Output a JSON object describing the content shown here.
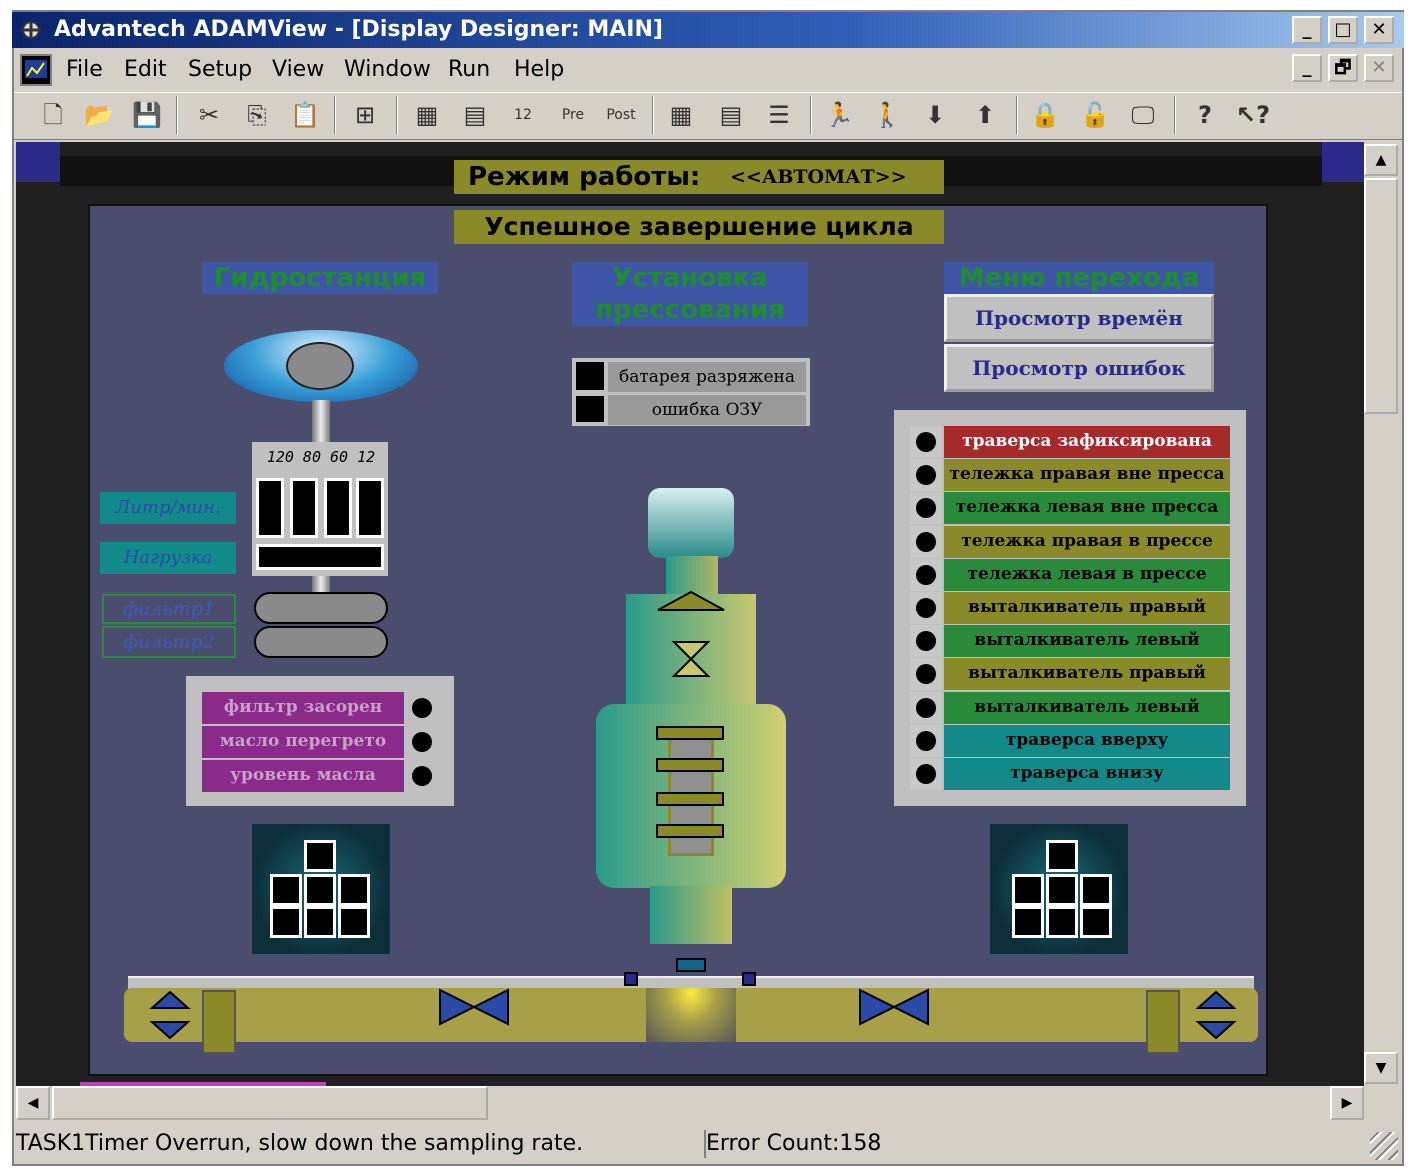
{
  "window": {
    "title": "Advantech ADAMView - [Display Designer: MAIN]",
    "controls": [
      "_",
      "□",
      "✕"
    ],
    "mdi_controls": [
      "_",
      "🗗",
      "✕"
    ]
  },
  "menu": [
    "File",
    "Edit",
    "Setup",
    "View",
    "Window",
    "Run",
    "Help"
  ],
  "toolbar": {
    "icons": [
      "new-file-icon",
      "open-folder-icon",
      "save-icon",
      "cut-icon",
      "copy-icon",
      "paste-icon",
      "insert-icon",
      "task-icon",
      "task-config-icon",
      "calendar-icon",
      "pre-icon",
      "post-icon",
      "block-icon",
      "block-config-icon",
      "list-icon",
      "run-icon",
      "stop-icon",
      "download-icon",
      "upload-icon",
      "lock-icon",
      "unlock-icon",
      "monitor-icon",
      "help-icon",
      "context-help-icon"
    ],
    "labels": {
      "pre": "Pre",
      "post": "Post",
      "calendar": "12"
    }
  },
  "display": {
    "mode_label": "Режим работы:",
    "mode_value": "<<АВТОМАТ>>",
    "cycle_status": "Успешное завершение цикла",
    "headers": {
      "hydro": "Гидростанция",
      "press": "Установка прессования",
      "menu": "Меню перехода"
    },
    "menu_buttons": [
      "Просмотр времён",
      "Просмотр ошибок"
    ],
    "press_alarms": [
      "батарея разряжена",
      "ошибка ОЗУ"
    ],
    "gauge_scale": "120 80 60 12",
    "hydro_labels": [
      "Литр/мин.",
      "Нагрузка"
    ],
    "filter_labels": [
      "фильтр1",
      "фильтр2"
    ],
    "hydro_alarms": [
      "фильтр засорен",
      "масло перегрето",
      "уровень масла"
    ],
    "status_list": [
      {
        "text": "траверса зафиксирована",
        "color": "#a52a2a",
        "textcolor": "#ffffff"
      },
      {
        "text": "тележка правая вне пресса",
        "color": "#8a8a28",
        "textcolor": "#000000"
      },
      {
        "text": "тележка левая вне пресса",
        "color": "#2a8a3c",
        "textcolor": "#000000"
      },
      {
        "text": "тележка правая в прессе",
        "color": "#8a8a28",
        "textcolor": "#000000"
      },
      {
        "text": "тележка левая в прессе",
        "color": "#2a8a3c",
        "textcolor": "#000000"
      },
      {
        "text": "выталкиватель правый внизу",
        "color": "#8a8a28",
        "textcolor": "#000000"
      },
      {
        "text": "выталкиватель левый внизу",
        "color": "#2a8a3c",
        "textcolor": "#000000"
      },
      {
        "text": "выталкиватель правый вверху",
        "color": "#8a8a28",
        "textcolor": "#000000"
      },
      {
        "text": "выталкиватель левый вверху",
        "color": "#2a8a3c",
        "textcolor": "#000000"
      },
      {
        "text": "траверса вверху",
        "color": "#138a8a",
        "textcolor": "#000000"
      },
      {
        "text": "траверса внизу",
        "color": "#138a8a",
        "textcolor": "#000000"
      }
    ]
  },
  "statusbar": {
    "message": "TASK1Timer Overrun, slow down the sampling rate.",
    "error_count": "Error Count:158"
  }
}
